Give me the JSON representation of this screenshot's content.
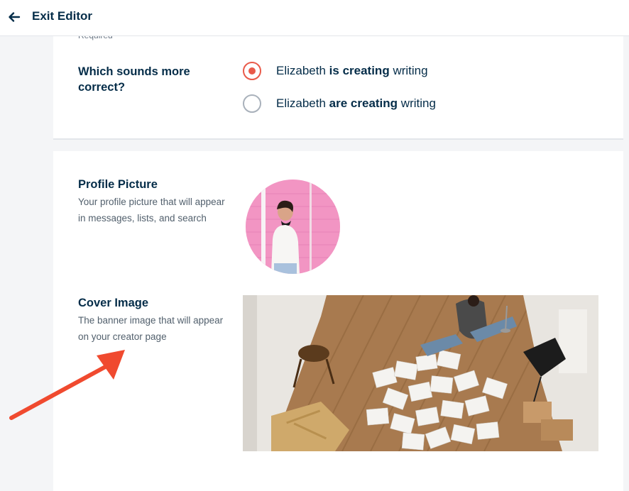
{
  "header": {
    "exit_label": "Exit Editor",
    "back_icon": "arrow-left-icon"
  },
  "grammar": {
    "required_label": "Required",
    "question": "Which sounds more correct?",
    "options": [
      {
        "name": "Elizabeth",
        "bold": "is creating",
        "rest": "writing",
        "selected": true
      },
      {
        "name": "Elizabeth",
        "bold": "are creating",
        "rest": "writing",
        "selected": false
      }
    ]
  },
  "profile_picture": {
    "title": "Profile Picture",
    "description": "Your profile picture that will appear in messages, lists, and search"
  },
  "cover_image": {
    "title": "Cover Image",
    "description": "The banner image that will appear on your creator page"
  },
  "colors": {
    "accent": "#e95a4a",
    "text": "#052d49",
    "background": "#f4f5f7",
    "annotation": "#f04a2f"
  }
}
